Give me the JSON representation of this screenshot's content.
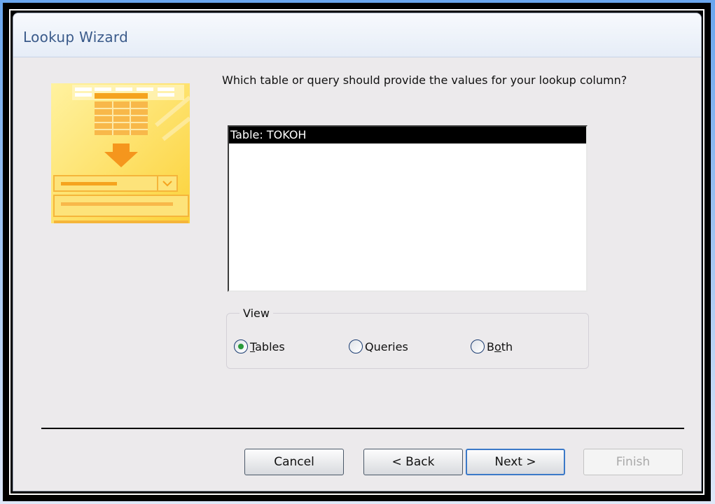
{
  "window": {
    "title": "Lookup Wizard"
  },
  "prompt": "Which table or query should provide the values for your lookup column?",
  "list": {
    "items": [
      "Table: TOKOH"
    ],
    "selected_index": 0
  },
  "view": {
    "legend": "View",
    "options": [
      {
        "label": "Tables",
        "accel": "T",
        "checked": true
      },
      {
        "label": "Queries",
        "accel": "",
        "checked": false
      },
      {
        "label": "Both",
        "accel": "o",
        "checked": false
      }
    ]
  },
  "buttons": {
    "cancel": "Cancel",
    "back": "< Back",
    "next": "Next >",
    "finish": "Finish"
  },
  "icons": {
    "illustration": "lookup-table-illustration-icon"
  },
  "colors": {
    "illustration_yellow": "#fcd23a",
    "illustration_orange": "#f5a31f",
    "selection": "#000000",
    "radio_dot": "#2a9a3a"
  }
}
